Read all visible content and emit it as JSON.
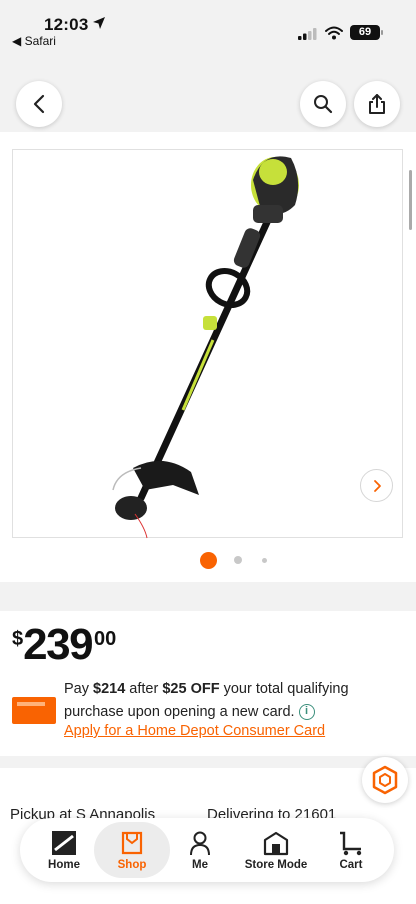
{
  "status_bar": {
    "time": "12:03",
    "back_app": "◀ Safari",
    "battery": "69"
  },
  "icons": {
    "back": "chevron-left-icon",
    "search": "search-icon",
    "share": "share-icon",
    "next": "chevron-right-icon"
  },
  "gallery": {
    "current_index": 1,
    "dots_visible": 3
  },
  "price": {
    "currency": "$",
    "dollars": "239",
    "cents": "00"
  },
  "offer": {
    "pay_prefix": "Pay ",
    "pay_amount": "$214",
    "after_text": " after ",
    "discount": "$25 OFF",
    "rest": " your total qualifying purchase upon opening a new card.",
    "info_symbol": "i",
    "apply_link": "Apply for a Home Depot Consumer Card"
  },
  "fulfillment": {
    "pickup": "Pickup at S Annapolis",
    "delivery": "Delivering to 21601"
  },
  "tabs": [
    {
      "label": "Home"
    },
    {
      "label": "Shop"
    },
    {
      "label": "Me"
    },
    {
      "label": "Store Mode"
    },
    {
      "label": "Cart"
    }
  ],
  "colors": {
    "accent": "#f96302",
    "info": "#3b8f7c",
    "trimmer_green": "#c6e03a"
  }
}
